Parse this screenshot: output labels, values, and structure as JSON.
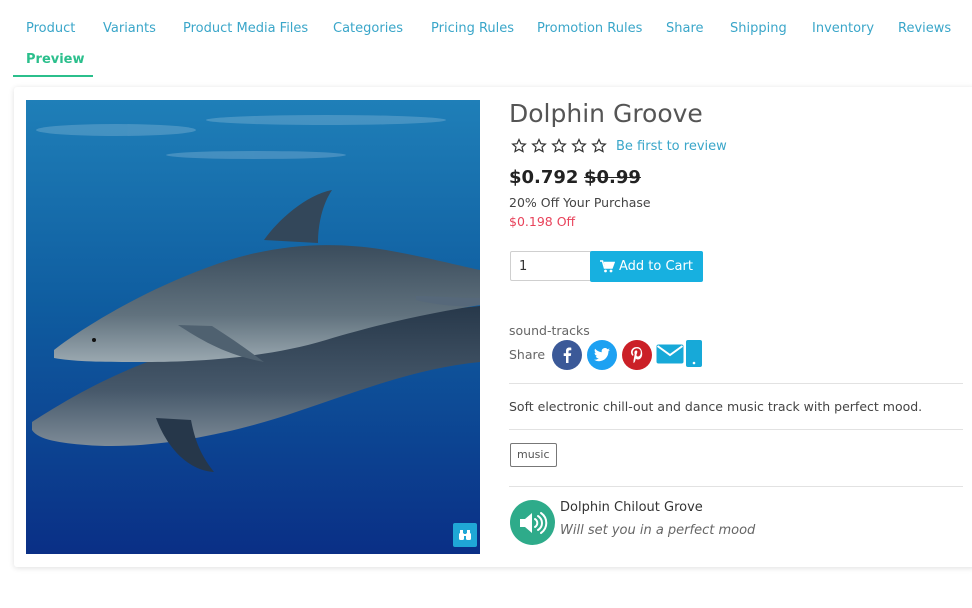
{
  "tabs": [
    {
      "label": "Product"
    },
    {
      "label": "Variants"
    },
    {
      "label": "Product Media Files"
    },
    {
      "label": "Categories"
    },
    {
      "label": "Pricing Rules"
    },
    {
      "label": "Promotion Rules"
    },
    {
      "label": "Share"
    },
    {
      "label": "Shipping"
    },
    {
      "label": "Inventory"
    },
    {
      "label": "Reviews"
    },
    {
      "label": "Preview"
    }
  ],
  "active_tab": "Preview",
  "product": {
    "title": "Dolphin Groove",
    "rating": 0,
    "rating_max": 5,
    "review_link": "Be first to review",
    "price": "$0.792",
    "old_price": "$0.99",
    "offer": "20% Off Your Purchase",
    "discount": "$0.198 Off",
    "quantity": "1",
    "add_to_cart": "Add to Cart",
    "category": "sound-tracks",
    "share_label": "Share",
    "share_icons": [
      "facebook-icon",
      "twitter-icon",
      "pinterest-icon",
      "email-icon",
      "mobile-icon"
    ],
    "description": "Soft electronic chill-out and dance music track with perfect mood.",
    "tags": [
      "music"
    ],
    "feature": {
      "icon": "speaker-icon",
      "title": "Dolphin Chilout Grove",
      "subtitle": "Will set you in a perfect mood"
    }
  },
  "colors": {
    "tab_link": "#3aa6c9",
    "tab_active": "#2bbf8c",
    "cart_button": "#17b0e0",
    "discount": "#e8435b",
    "feature_icon": "#2eab8a",
    "facebook": "#3b5998",
    "twitter": "#1da1f2",
    "pinterest": "#cb2027",
    "email": "#17a9d8"
  }
}
